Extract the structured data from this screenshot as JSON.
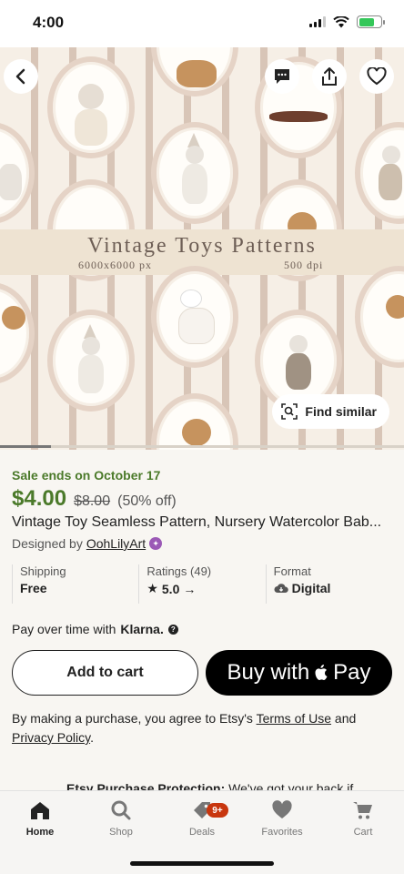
{
  "status_bar": {
    "time": "4:00"
  },
  "hero": {
    "title": "Vintage Toys Patterns",
    "resolution": "6000x6000 px",
    "dpi": "500 dpi",
    "find_similar_label": "Find similar"
  },
  "product": {
    "sale_text": "Sale ends on October 17",
    "price": "$4.00",
    "original_price": "$8.00",
    "discount": "(50% off)",
    "title": "Vintage Toy Seamless Pattern, Nursery Watercolor Bab...",
    "designed_by_prefix": "Designed by",
    "designer": "OohLilyArt"
  },
  "info": {
    "shipping_label": "Shipping",
    "shipping_value": "Free",
    "ratings_label": "Ratings (49)",
    "ratings_value": "5.0",
    "format_label": "Format",
    "format_value": "Digital"
  },
  "payment": {
    "klarna_text": "Pay over time with",
    "klarna_brand": "Klarna.",
    "add_to_cart": "Add to cart",
    "buy_with": "Buy with",
    "pay": "Pay"
  },
  "terms": {
    "prefix": "By making a purchase, you agree to Etsy's",
    "terms_link": "Terms of Use",
    "and": "and",
    "privacy_link": "Privacy Policy",
    "suffix": "."
  },
  "protection": {
    "title": "Etsy Purchase Protection:",
    "text": "We've got your back if"
  },
  "nav": {
    "home": "Home",
    "shop": "Shop",
    "deals": "Deals",
    "deals_badge": "9+",
    "favorites": "Favorites",
    "cart": "Cart"
  },
  "colors": {
    "sale_green": "#4b7a2a",
    "badge_orange": "#c8360e",
    "battery_green": "#34c759"
  }
}
